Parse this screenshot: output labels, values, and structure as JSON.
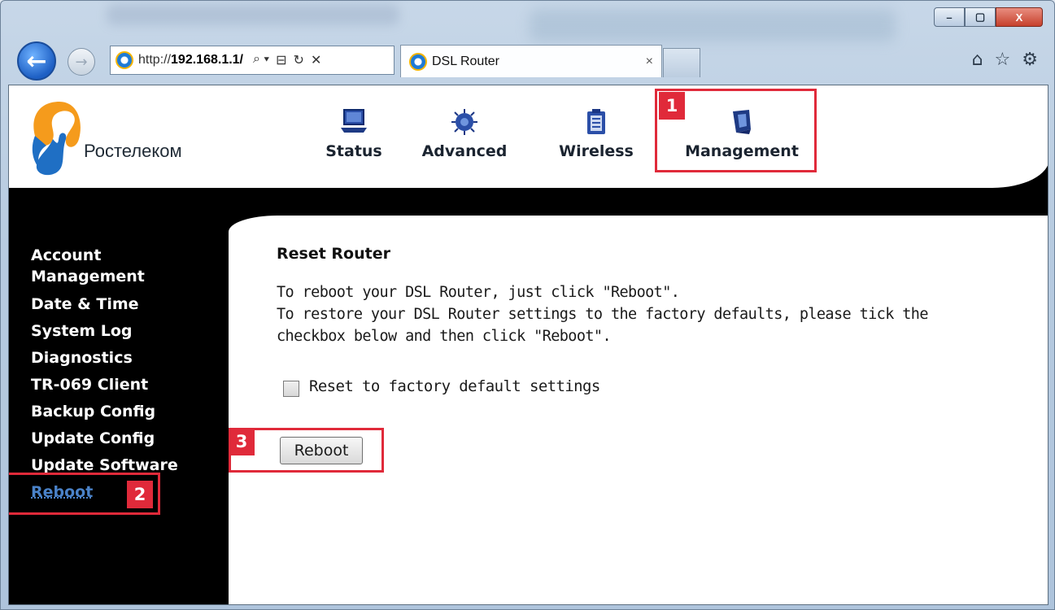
{
  "browser": {
    "url_prefix": "http://",
    "url_host": "192.168.1.1/",
    "address_tools": [
      "⌕ ▾",
      "⊟",
      "↻",
      "✕"
    ],
    "tab_title": "DSL Router",
    "tab_close": "×",
    "back_glyph": "←",
    "forward_glyph": "→",
    "right_tools": [
      "⌂",
      "☆",
      "⚙"
    ],
    "window_controls": [
      "–",
      "▢",
      "X"
    ]
  },
  "header": {
    "brand": "Ростелеком",
    "nav": [
      {
        "label": "Status",
        "icon": "laptop-icon"
      },
      {
        "label": "Advanced",
        "icon": "chip-icon"
      },
      {
        "label": "Wireless",
        "icon": "clipboard-icon"
      },
      {
        "label": "Management",
        "icon": "shield-icon"
      }
    ]
  },
  "sidebar": {
    "items": [
      {
        "label": "Account"
      },
      {
        "label": "Management"
      },
      {
        "label": "Date & Time"
      },
      {
        "label": "System Log"
      },
      {
        "label": "Diagnostics"
      },
      {
        "label": "TR-069 Client"
      },
      {
        "label": "Backup Config"
      },
      {
        "label": "Update Config"
      },
      {
        "label": "Update Software"
      },
      {
        "label": "Reboot",
        "active": true
      }
    ]
  },
  "content": {
    "heading": "Reset Router",
    "lines": [
      "To reboot your DSL Router, just click \"Reboot\".",
      "To restore your DSL Router settings to the factory defaults, please tick the",
      "checkbox below and then click \"Reboot\"."
    ],
    "checkbox_label": "Reset to factory default settings",
    "checkbox_checked": false,
    "reboot_button": "Reboot"
  },
  "annotations": [
    "1",
    "2",
    "3"
  ],
  "colors": {
    "annotation_red": "#e02a3a",
    "active_link": "#4a82c8",
    "brand_blue": "#1f6fc4",
    "brand_orange": "#f59b1c"
  }
}
